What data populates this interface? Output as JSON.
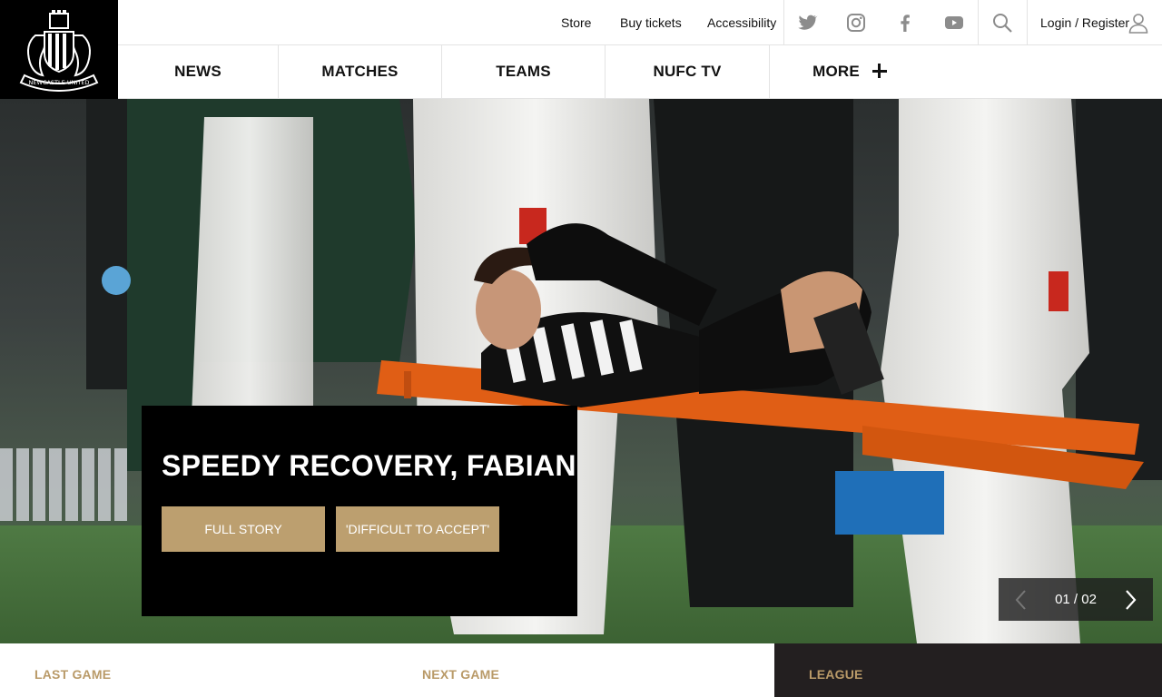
{
  "brand": {
    "crest_text": "NEWCASTLE UNITED",
    "accent": "#bc9f6f",
    "label_color": "#b99a68"
  },
  "utility": {
    "links": [
      "Store",
      "Buy tickets",
      "Accessibility"
    ],
    "social": [
      "twitter-icon",
      "instagram-icon",
      "facebook-icon",
      "youtube-icon"
    ],
    "search_icon": "search-icon",
    "login_label": "Login / Register",
    "user_icon": "user-icon"
  },
  "nav": {
    "items": [
      "NEWS",
      "MATCHES",
      "TEAMS",
      "NUFC TV"
    ],
    "more_label": "MORE",
    "more_icon": "plus-icon"
  },
  "hero": {
    "headline": "SPEEDY RECOVERY, FABIAN",
    "buttons": [
      "FULL STORY",
      "'DIFFICULT TO ACCEPT'"
    ],
    "pager": {
      "current": "01",
      "total": "02",
      "label": "01 / 02"
    }
  },
  "bottom": {
    "last_game": "LAST GAME",
    "next_game": "NEXT GAME",
    "league": "LEAGUE"
  }
}
